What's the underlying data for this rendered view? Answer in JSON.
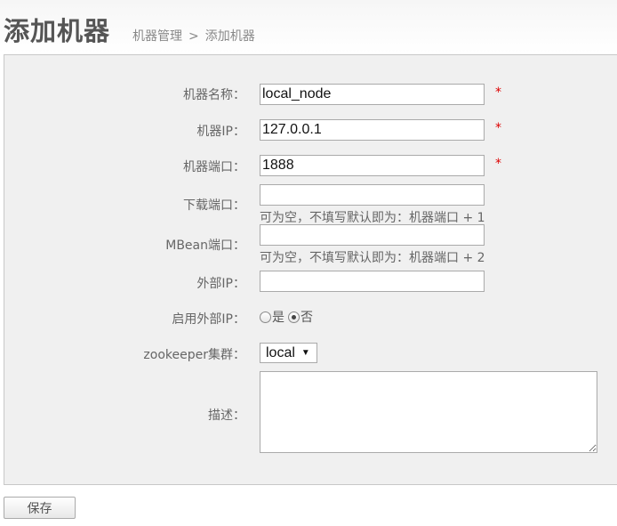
{
  "header": {
    "title": "添加机器",
    "breadcrumb": {
      "parent": "机器管理",
      "separator": ">",
      "current": "添加机器"
    }
  },
  "form": {
    "machine_name": {
      "label": "机器名称：",
      "value": "local_node",
      "required": "*"
    },
    "machine_ip": {
      "label": "机器IP：",
      "value": "127.0.0.1",
      "required": "*"
    },
    "machine_port": {
      "label": "机器端口：",
      "value": "1888",
      "required": "*"
    },
    "download_port": {
      "label": "下载端口：",
      "value": "",
      "hint": "可为空，不填写默认即为：机器端口 + 1"
    },
    "mbean_port": {
      "label": "MBean端口：",
      "value": "",
      "hint": "可为空，不填写默认即为：机器端口 + 2"
    },
    "external_ip": {
      "label": "外部IP：",
      "value": ""
    },
    "use_external_ip": {
      "label": "启用外部IP：",
      "option_yes": "是",
      "option_no": "否",
      "selected": "否"
    },
    "zookeeper_cluster": {
      "label": "zookeeper集群：",
      "selected": "local"
    },
    "description": {
      "label": "描述：",
      "value": ""
    }
  },
  "actions": {
    "save_label": "保存"
  }
}
